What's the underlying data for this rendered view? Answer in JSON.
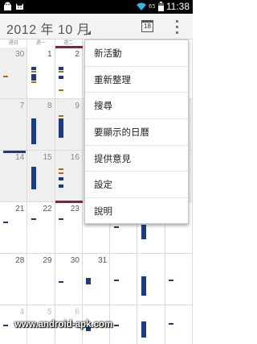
{
  "statusbar": {
    "left_icons": [
      "android-debug-icon",
      "cat-face-icon"
    ],
    "battery_level": "65",
    "time": "11:38"
  },
  "actionbar": {
    "title": "2012 年 10 月",
    "today_icon_day": "18"
  },
  "weekday_headers": [
    "週日",
    "週一",
    "週二",
    "",
    "",
    "",
    ""
  ],
  "weeks": [
    [
      "30",
      "1",
      "2",
      "",
      "",
      "",
      ""
    ],
    [
      "7",
      "8",
      "9",
      "",
      "",
      "",
      ""
    ],
    [
      "14",
      "15",
      "16",
      "",
      "",
      "",
      ""
    ],
    [
      "21",
      "22",
      "23",
      "",
      "",
      "",
      ""
    ],
    [
      "28",
      "29",
      "30",
      "31",
      "",
      "",
      ""
    ],
    [
      "4",
      "5",
      "6",
      "",
      "",
      "",
      ""
    ]
  ],
  "menu": {
    "items": [
      "新活動",
      "重新整理",
      "搜尋",
      "要顯示的日曆",
      "提供意見",
      "設定",
      "說明"
    ]
  },
  "watermark": "www.android-apk.com",
  "colors": {
    "event_navy": "#1a3a8a",
    "event_orange": "#b36a12",
    "event_maroon": "#8a1f3a",
    "grey_cell": "#efefef"
  }
}
